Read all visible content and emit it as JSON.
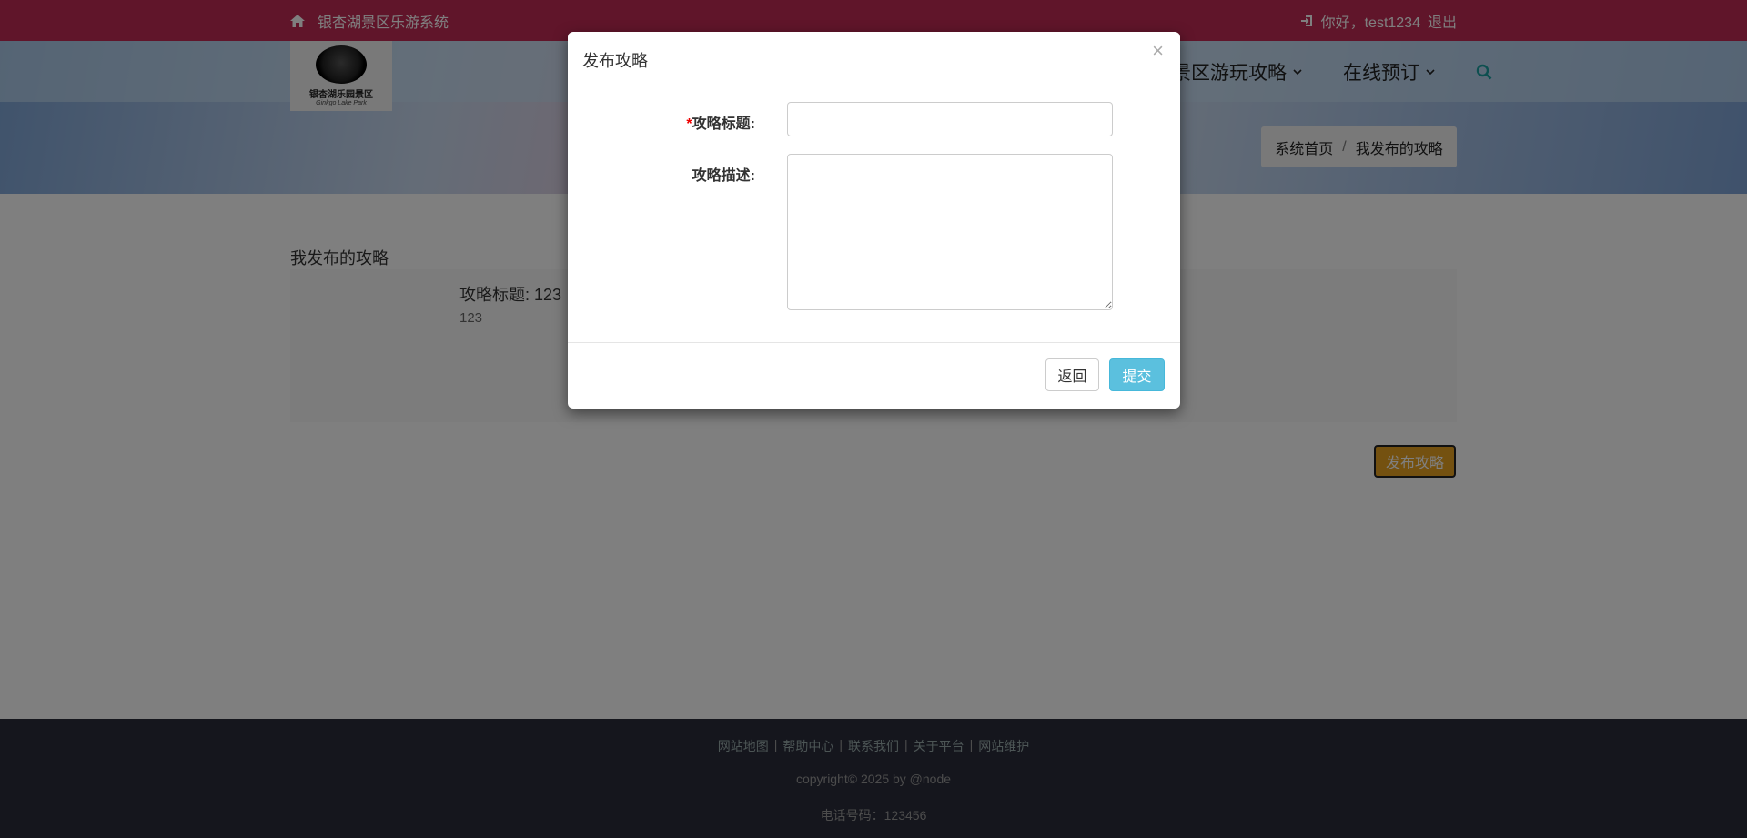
{
  "topbar": {
    "site_name": "银杏湖景区乐游系统",
    "greeting": "你好，test1234",
    "logout": "退出",
    "home_icon": "home-icon",
    "login_icon": "sign-in-icon"
  },
  "logo": {
    "text": "银杏湖乐园景区",
    "sub": "Ginkgo Lake Park"
  },
  "nav": {
    "items": [
      {
        "label": "景区游玩攻略"
      },
      {
        "label": "在线预订"
      }
    ],
    "search_icon": "search-icon"
  },
  "breadcrumb": {
    "home": "系统首页",
    "separator": "/",
    "current": "我发布的攻略"
  },
  "main": {
    "section_title": "我发布的攻略",
    "card": {
      "title": "攻略标题: 123",
      "desc": "123"
    },
    "publish_button": "发布攻略"
  },
  "footer": {
    "links": [
      "网站地图",
      "帮助中心",
      "联系我们",
      "关于平台",
      "网站维护"
    ],
    "separator": "|",
    "copyright": "copyright© 2025 by @node",
    "phone": "电话号码：123456"
  },
  "modal": {
    "title": "发布攻略",
    "close": "×",
    "required_mark": "*",
    "title_label": "攻略标题:",
    "title_value": "",
    "desc_label": "攻略描述:",
    "desc_value": "",
    "back_button": "返回",
    "submit_button": "提交"
  },
  "colors": {
    "topbar": "#c12a55",
    "publish": "#e8a220",
    "submit": "#5bc0de",
    "footer": "#2a2c3b"
  }
}
